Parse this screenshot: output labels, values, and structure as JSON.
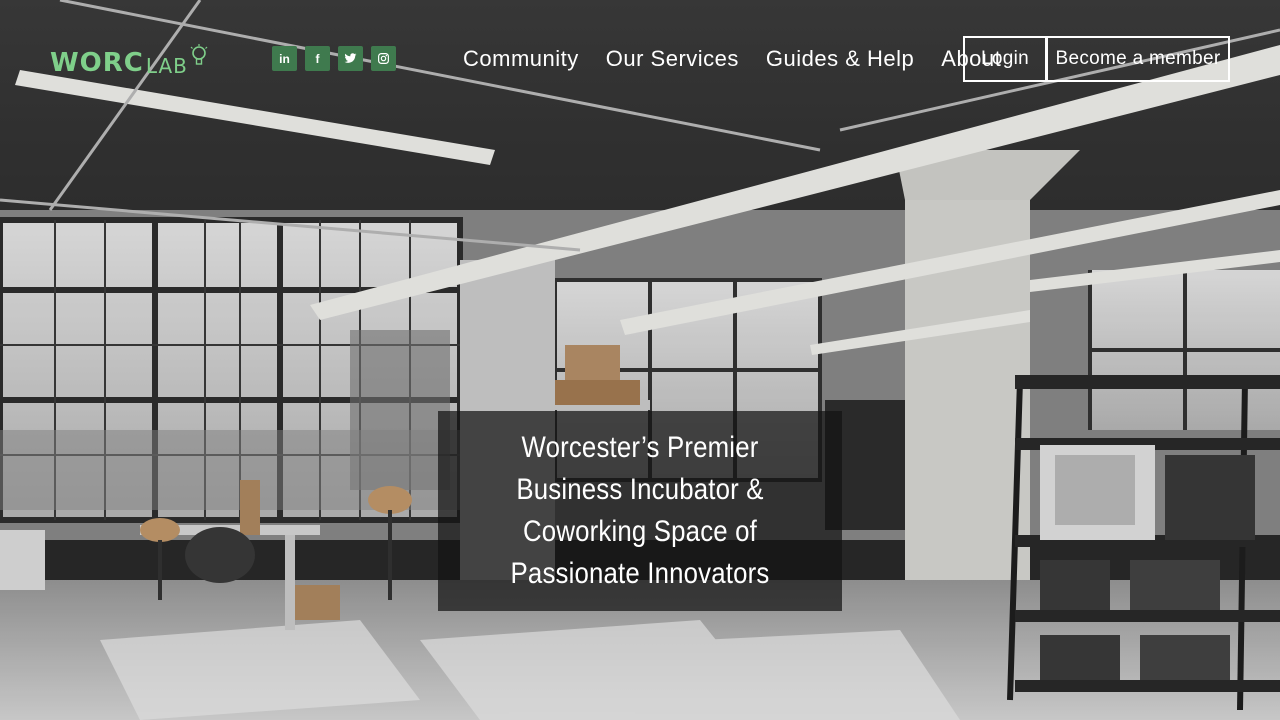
{
  "brand": {
    "logo_main": "WORC",
    "logo_sub": "LAB"
  },
  "social": [
    {
      "icon": "linkedin-icon",
      "label": "in"
    },
    {
      "icon": "facebook-icon",
      "label": "f"
    },
    {
      "icon": "twitter-icon",
      "label": ""
    },
    {
      "icon": "instagram-icon",
      "label": ""
    }
  ],
  "nav": {
    "items": [
      "Community",
      "Our Services",
      "Guides & Help",
      "About"
    ],
    "login_label": "Login",
    "member_label": "Become a member"
  },
  "hero": {
    "headline_lines": [
      "Worcester’s Premier",
      "Business Incubator &",
      "Coworking Space of",
      "Passionate Innovators"
    ]
  },
  "colors": {
    "brand_green": "#7fcf8a",
    "social_bg": "#3f7a4e",
    "overlay": "rgba(20,20,20,0.72)"
  }
}
